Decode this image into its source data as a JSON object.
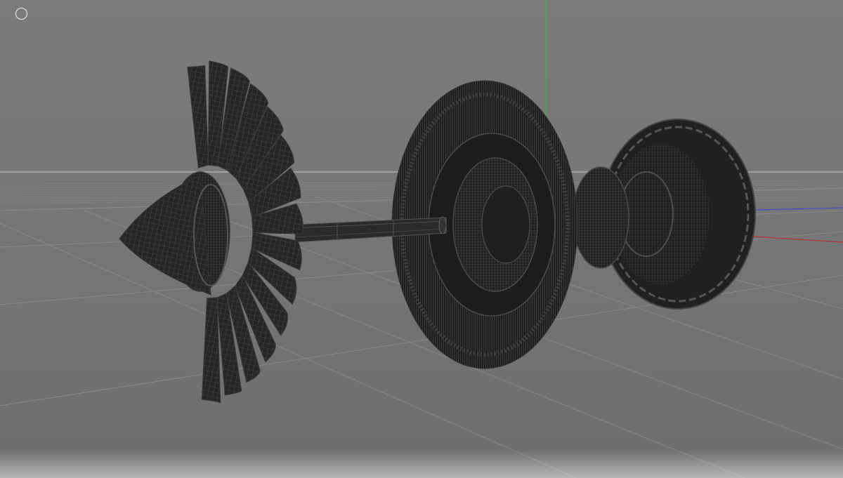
{
  "viewport": {
    "view_indicator_icon": "circle-outline-icon",
    "colors": {
      "background": "#777777",
      "grid_line": "#8a8a8a",
      "horizon_line": "#c8c8c8",
      "axis_y": "#2fb83a",
      "axis_x": "#b83030",
      "axis_z": "#4050c0",
      "mesh_fill": "#262626",
      "wireframe": "#5d5d5d"
    },
    "model": {
      "parts": [
        "fan-rotor",
        "spinner-cone",
        "drive-shaft",
        "compressor-disk",
        "turbine-section"
      ]
    }
  }
}
